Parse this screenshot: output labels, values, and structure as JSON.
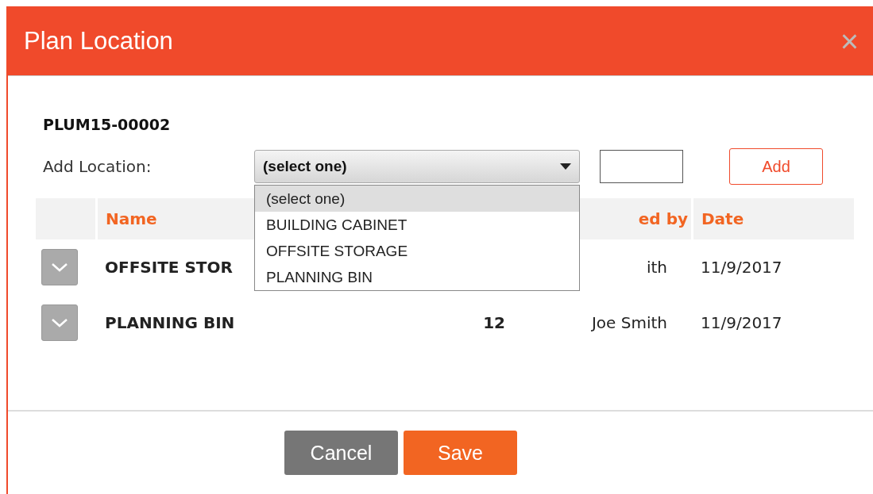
{
  "dialog": {
    "title": "Plan Location",
    "close": "×"
  },
  "record_id": "PLUM15-00002",
  "add_location": {
    "label": "Add Location:",
    "select": {
      "value": "(select one)",
      "expanded": true,
      "options": [
        {
          "label": "(select one)",
          "selected": true
        },
        {
          "label": "BUILDING CABINET",
          "selected": false
        },
        {
          "label": "OFFSITE STORAGE",
          "selected": false
        },
        {
          "label": "PLANNING BIN",
          "selected": false
        }
      ]
    },
    "add_button": "Add"
  },
  "table": {
    "columns": {
      "name": "Name",
      "by": "ed by",
      "date": "Date"
    },
    "rows": [
      {
        "name": "OFFSITE STOR",
        "by": "ith",
        "date": "11/9/2017"
      },
      {
        "name": "PLANNING BIN",
        "count": "12",
        "by": "Joe Smith",
        "date": "11/9/2017"
      }
    ]
  },
  "buttons": {
    "cancel": "Cancel",
    "save": "Save"
  }
}
